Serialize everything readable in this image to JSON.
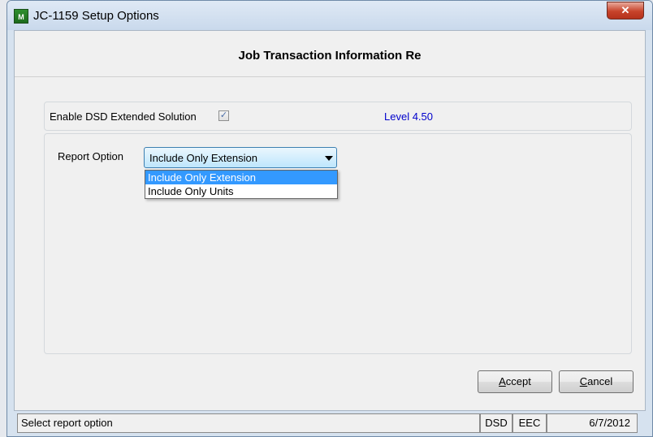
{
  "window": {
    "title": "JC-1159 Setup Options",
    "app_icon_text": "M",
    "close_symbol": "✕"
  },
  "form": {
    "heading": "Job Transaction Information Re",
    "enable_label": "Enable DSD Extended Solution",
    "enable_checked": true,
    "check_mark": "✓",
    "level_text": "Level  4.50",
    "report_option_label": "Report Option",
    "report_option_value": "Include Only Extension",
    "report_options": [
      "Include Only Extension",
      "Include Only Units"
    ]
  },
  "buttons": {
    "accept_accel": "A",
    "accept_rest": "ccept",
    "cancel_accel": "C",
    "cancel_rest": "ancel"
  },
  "statusbar": {
    "message": "Select report option",
    "panel1": "DSD",
    "panel2": "EEC",
    "date": "6/7/2012"
  },
  "colors": {
    "level_text": "#0000cc",
    "selected_option_bg": "#3399ff",
    "close_button": "#c7432a"
  },
  "icons": {
    "app": "app-logo-icon",
    "close": "close-icon",
    "checkbox": "checkmark-icon",
    "dropdown": "chevron-down-icon"
  }
}
